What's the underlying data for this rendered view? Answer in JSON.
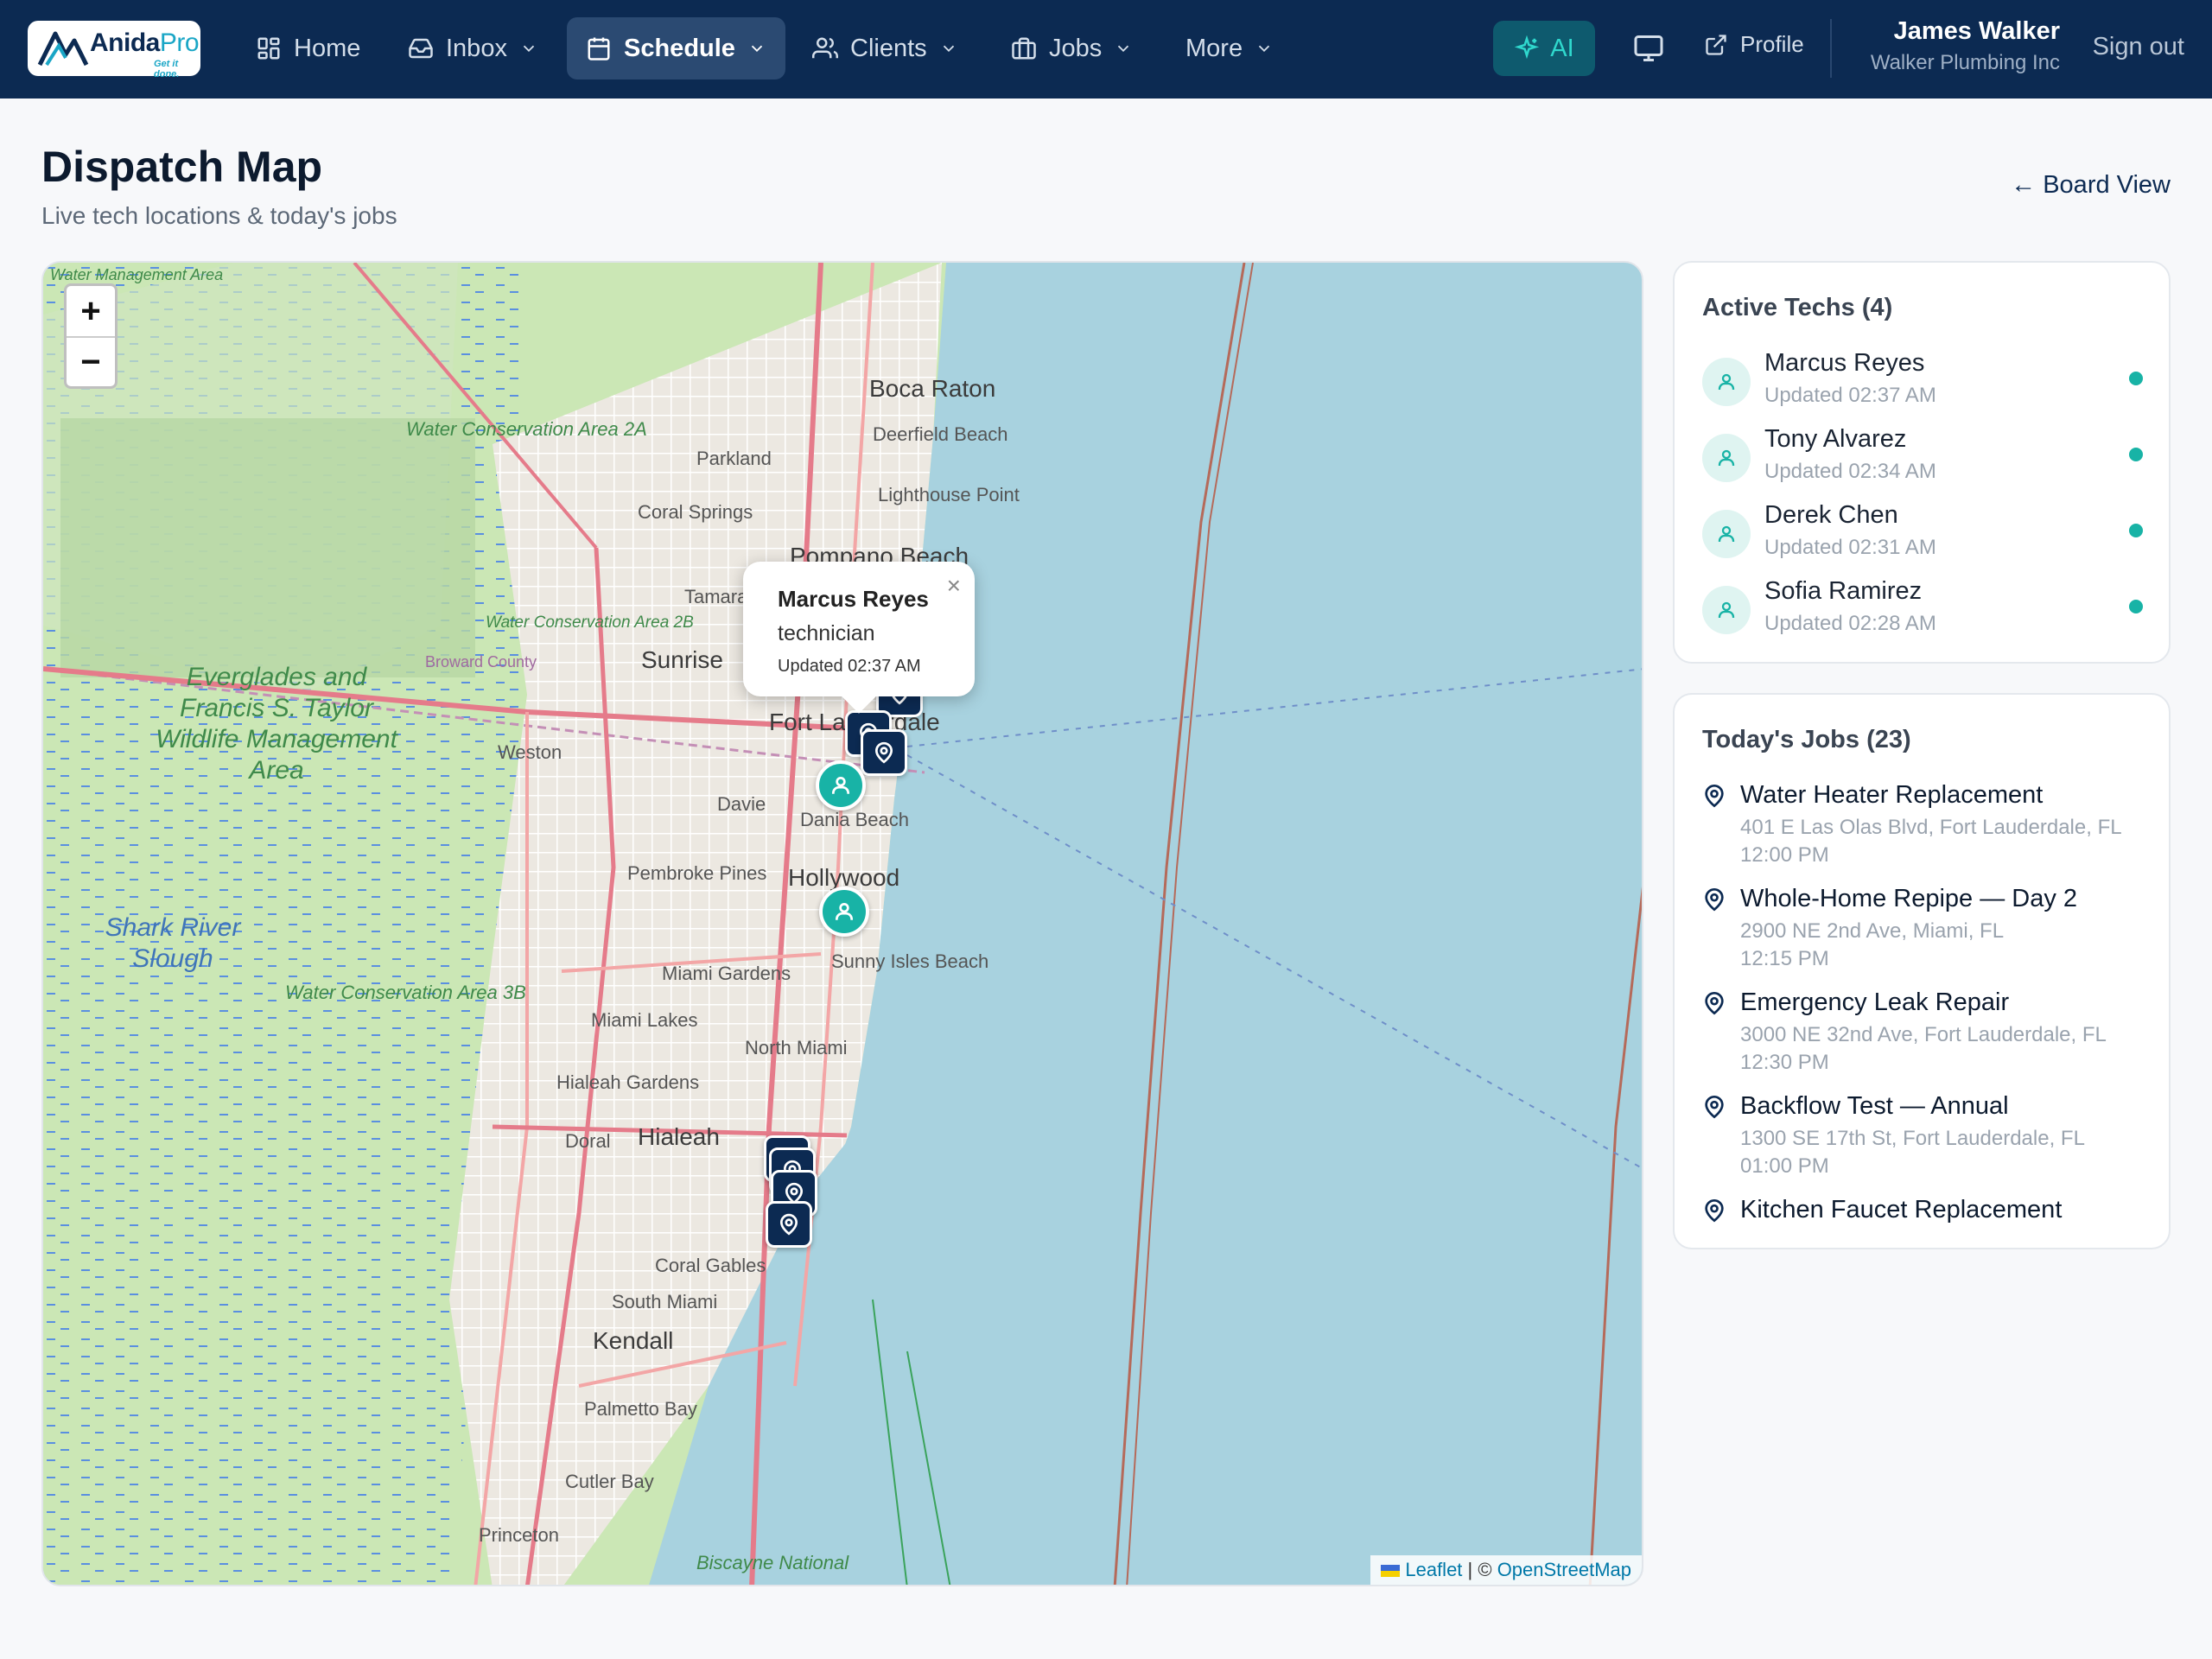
{
  "brand": {
    "name_main": "Anida",
    "name_accent": "Pro",
    "tagline": "Get it done."
  },
  "nav": {
    "items": [
      {
        "label": "Home",
        "icon": "grid-icon",
        "active": false,
        "dropdown": false
      },
      {
        "label": "Inbox",
        "icon": "inbox-icon",
        "active": false,
        "dropdown": true
      },
      {
        "label": "Schedule",
        "icon": "calendar-icon",
        "active": true,
        "dropdown": true
      },
      {
        "label": "Clients",
        "icon": "users-icon",
        "active": false,
        "dropdown": true
      },
      {
        "label": "Jobs",
        "icon": "briefcase-icon",
        "active": false,
        "dropdown": true
      },
      {
        "label": "More",
        "icon": "",
        "active": false,
        "dropdown": true
      }
    ],
    "ai_label": "AI",
    "profile_label": "Profile",
    "user_name": "James Walker",
    "user_company": "Walker Plumbing Inc",
    "signout_label": "Sign out"
  },
  "header": {
    "title": "Dispatch Map",
    "subtitle": "Live tech locations & today's jobs",
    "board_link": "← Board View"
  },
  "map": {
    "labels": [
      "Boca Raton",
      "Deerfield Beach",
      "Parkland",
      "Lighthouse Point",
      "Coral Springs",
      "Pompano Beach",
      "Tamarac",
      "Sunrise",
      "Fort Lauderdale",
      "Weston",
      "Davie",
      "Dania Beach",
      "Pembroke Pines",
      "Hollywood",
      "Sunny Isles Beach",
      "Miami Gardens",
      "Miami Lakes",
      "North Miami",
      "Hialeah Gardens",
      "Doral",
      "Hialeah",
      "Coral Gables",
      "South Miami",
      "Kendall",
      "Palmetto Bay",
      "Cutler Bay",
      "Princeton",
      "Broward County"
    ],
    "area_labels": [
      "Water Conservation Area 2A",
      "Water Conservation Area 2B",
      "Water Conservation Area 3B",
      "Everglades and Francis S. Taylor Wildlife Management Area",
      "Shark River Slough",
      "Water Management Area",
      "Biscayne National"
    ],
    "zoom_in": "+",
    "zoom_out": "−",
    "attribution_leaflet": "Leaflet",
    "attribution_sep": " | © ",
    "attribution_osm": "OpenStreetMap",
    "popup": {
      "name": "Marcus Reyes",
      "role": "technician",
      "updated": "Updated 02:37 AM",
      "close": "×"
    }
  },
  "techs": {
    "title": "Active Techs (4)",
    "items": [
      {
        "name": "Marcus Reyes",
        "updated": "Updated 02:37 AM"
      },
      {
        "name": "Tony Alvarez",
        "updated": "Updated 02:34 AM"
      },
      {
        "name": "Derek Chen",
        "updated": "Updated 02:31 AM"
      },
      {
        "name": "Sofia Ramirez",
        "updated": "Updated 02:28 AM"
      }
    ]
  },
  "jobs": {
    "title": "Today's Jobs (23)",
    "items": [
      {
        "title": "Water Heater Replacement",
        "address": "401 E Las Olas Blvd, Fort Lauderdale, FL",
        "time": "12:00 PM"
      },
      {
        "title": "Whole-Home Repipe — Day 2",
        "address": "2900 NE 2nd Ave, Miami, FL",
        "time": "12:15 PM"
      },
      {
        "title": "Emergency Leak Repair",
        "address": "3000 NE 32nd Ave, Fort Lauderdale, FL",
        "time": "12:30 PM"
      },
      {
        "title": "Backflow Test — Annual",
        "address": "1300 SE 17th St, Fort Lauderdale, FL",
        "time": "01:00 PM"
      },
      {
        "title": "Kitchen Faucet Replacement",
        "address": "",
        "time": ""
      }
    ]
  },
  "colors": {
    "navy": "#0c2a52",
    "teal": "#18b3a6",
    "water": "#a8d2df",
    "park": "#c8e6b4"
  }
}
